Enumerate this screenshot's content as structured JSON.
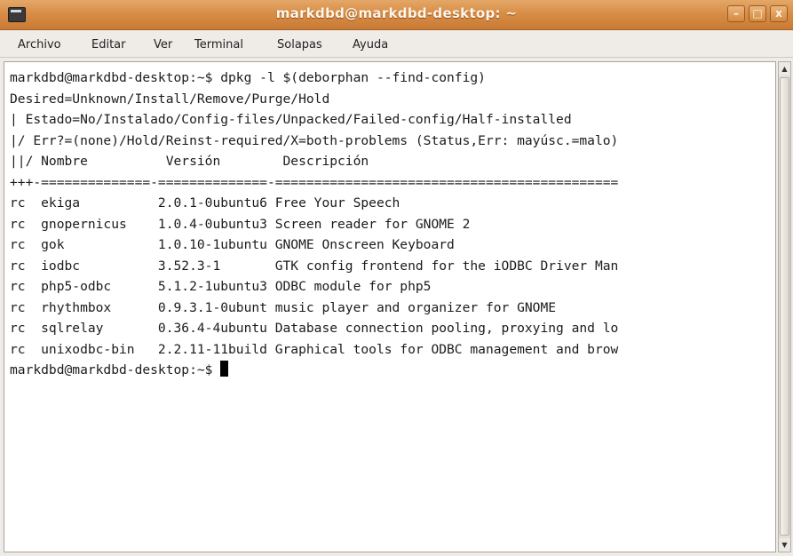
{
  "window": {
    "title": "markdbd@markdbd-desktop: ~",
    "buttons": {
      "minimize": "–",
      "maximize": "□",
      "close": "x"
    }
  },
  "menu": {
    "items": [
      {
        "label": "Archivo"
      },
      {
        "label": "Editar"
      },
      {
        "label": "Ver"
      },
      {
        "label": "Terminal"
      },
      {
        "label": "Solapas"
      },
      {
        "label": "Ayuda"
      }
    ]
  },
  "terminal": {
    "lines": [
      "markdbd@markdbd-desktop:~$ dpkg -l $(deborphan --find-config)",
      "Desired=Unknown/Install/Remove/Purge/Hold",
      "| Estado=No/Instalado/Config-files/Unpacked/Failed-config/Half-installed",
      "|/ Err?=(none)/Hold/Reinst-required/X=both-problems (Status,Err: mayúsc.=malo)",
      "||/ Nombre          Versión        Descripción",
      "+++-==============-==============-============================================",
      "rc  ekiga          2.0.1-0ubuntu6 Free Your Speech",
      "rc  gnopernicus    1.0.4-0ubuntu3 Screen reader for GNOME 2",
      "rc  gok            1.0.10-1ubuntu GNOME Onscreen Keyboard",
      "rc  iodbc          3.52.3-1       GTK config frontend for the iODBC Driver Man",
      "rc  php5-odbc      5.1.2-1ubuntu3 ODBC module for php5",
      "rc  rhythmbox      0.9.3.1-0ubunt music player and organizer for GNOME",
      "rc  sqlrelay       0.36.4-4ubuntu Database connection pooling, proxying and lo",
      "rc  unixodbc-bin   2.2.11-11build Graphical tools for ODBC management and brow"
    ],
    "prompt": "markdbd@markdbd-desktop:~$ "
  },
  "scrollbar": {
    "up_glyph": "▲",
    "down_glyph": "▼"
  },
  "colors": {
    "titlebar": "#d88e47",
    "background": "#efebe7",
    "terminal_bg": "#ffffff",
    "terminal_fg": "#1b1b1b"
  }
}
